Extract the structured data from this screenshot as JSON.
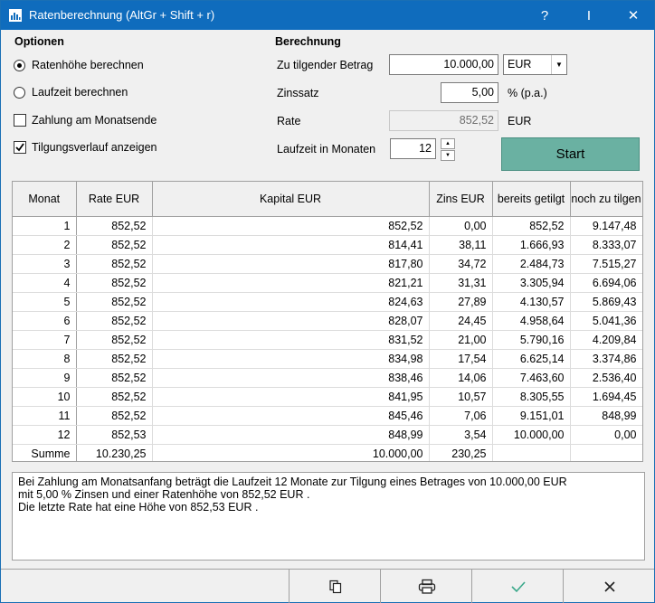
{
  "window": {
    "title": "Ratenberechnung (AltGr + Shift + r)",
    "help_label": "?",
    "pin_label": "I",
    "close_label": "✕"
  },
  "options": {
    "heading": "Optionen",
    "items": [
      {
        "label": "Ratenhöhe berechnen",
        "type": "radio",
        "checked": true
      },
      {
        "label": "Laufzeit berechnen",
        "type": "radio",
        "checked": false
      },
      {
        "label": "Zahlung am Monatsende",
        "type": "checkbox",
        "checked": false
      },
      {
        "label": "Tilgungsverlauf anzeigen",
        "type": "checkbox",
        "checked": true
      }
    ]
  },
  "calc": {
    "heading": "Berechnung",
    "amount_label": "Zu tilgender Betrag",
    "amount_value": "10.000,00",
    "currency_selected": "EUR",
    "rate_label": "Zinssatz",
    "rate_value": "5,00",
    "rate_unit": "% (p.a.)",
    "installment_label": "Rate",
    "installment_value": "852,52",
    "installment_unit": "EUR",
    "term_label": "Laufzeit in Monaten",
    "term_value": "12",
    "start_label": "Start"
  },
  "table": {
    "columns": [
      "Monat",
      "Rate EUR",
      "Kapital EUR",
      "Zins EUR",
      "bereits getilgt",
      "noch zu tilgen"
    ],
    "rows": [
      [
        "1",
        "852,52",
        "852,52",
        "0,00",
        "852,52",
        "9.147,48"
      ],
      [
        "2",
        "852,52",
        "814,41",
        "38,11",
        "1.666,93",
        "8.333,07"
      ],
      [
        "3",
        "852,52",
        "817,80",
        "34,72",
        "2.484,73",
        "7.515,27"
      ],
      [
        "4",
        "852,52",
        "821,21",
        "31,31",
        "3.305,94",
        "6.694,06"
      ],
      [
        "5",
        "852,52",
        "824,63",
        "27,89",
        "4.130,57",
        "5.869,43"
      ],
      [
        "6",
        "852,52",
        "828,07",
        "24,45",
        "4.958,64",
        "5.041,36"
      ],
      [
        "7",
        "852,52",
        "831,52",
        "21,00",
        "5.790,16",
        "4.209,84"
      ],
      [
        "8",
        "852,52",
        "834,98",
        "17,54",
        "6.625,14",
        "3.374,86"
      ],
      [
        "9",
        "852,52",
        "838,46",
        "14,06",
        "7.463,60",
        "2.536,40"
      ],
      [
        "10",
        "852,52",
        "841,95",
        "10,57",
        "8.305,55",
        "1.694,45"
      ],
      [
        "11",
        "852,52",
        "845,46",
        "7,06",
        "9.151,01",
        "848,99"
      ],
      [
        "12",
        "852,53",
        "848,99",
        "3,54",
        "10.000,00",
        "0,00"
      ]
    ],
    "sum_row": [
      "Summe",
      "10.230,25",
      "10.000,00",
      "230,25",
      "",
      ""
    ]
  },
  "info": {
    "lines": [
      "Bei Zahlung am Monatsanfang beträgt die Laufzeit 12 Monate zur Tilgung eines Betrages von 10.000,00 EUR",
      "mit 5,00 % Zinsen und einer Ratenhöhe von 852,52 EUR .",
      "Die letzte Rate hat eine Höhe von 852,53 EUR ."
    ]
  },
  "toolbar": {
    "icons": [
      "copy-icon",
      "print-icon",
      "checkmark-icon",
      "close-icon"
    ],
    "accent": "#3aa88a"
  }
}
